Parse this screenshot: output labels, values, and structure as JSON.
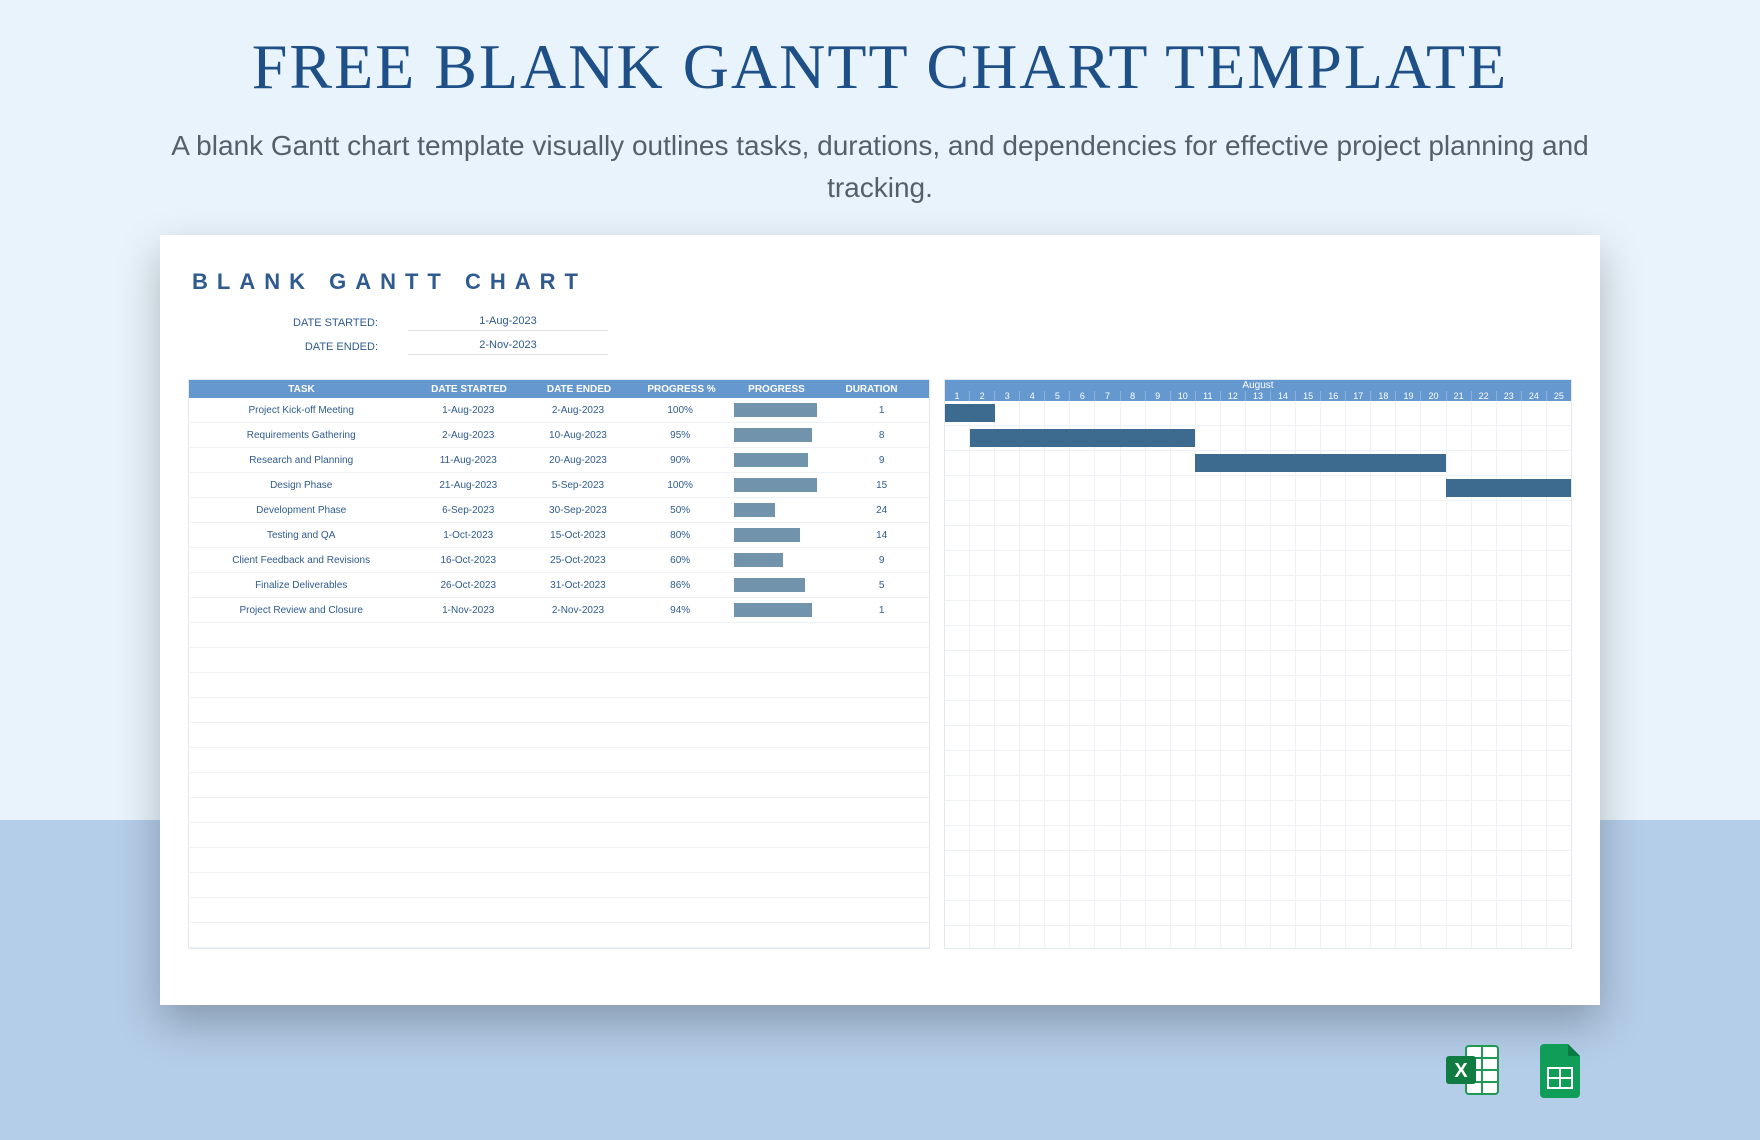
{
  "hero": {
    "title": "FREE BLANK GANTT CHART TEMPLATE",
    "subtitle": "A blank Gantt chart template visually outlines tasks, durations, and dependencies for effective project planning and tracking."
  },
  "sheet": {
    "title": "BLANK GANTT CHART",
    "meta_labels": {
      "started": "DATE STARTED:",
      "ended": "DATE ENDED:"
    },
    "meta_values": {
      "started": "1-Aug-2023",
      "ended": "2-Nov-2023"
    },
    "columns": {
      "task": "TASK",
      "date_started": "DATE STARTED",
      "date_ended": "DATE ENDED",
      "progress_pct": "PROGRESS %",
      "progress": "PROGRESS",
      "duration": "DURATION"
    },
    "rows": [
      {
        "task": "Project Kick-off Meeting",
        "date_started": "1-Aug-2023",
        "date_ended": "2-Aug-2023",
        "progress_pct": "100%",
        "duration": "1",
        "start_day": 1,
        "span": 2
      },
      {
        "task": "Requirements Gathering",
        "date_started": "2-Aug-2023",
        "date_ended": "10-Aug-2023",
        "progress_pct": "95%",
        "duration": "8",
        "start_day": 2,
        "span": 9
      },
      {
        "task": "Research and Planning",
        "date_started": "11-Aug-2023",
        "date_ended": "20-Aug-2023",
        "progress_pct": "90%",
        "duration": "9",
        "start_day": 11,
        "span": 10
      },
      {
        "task": "Design Phase",
        "date_started": "21-Aug-2023",
        "date_ended": "5-Sep-2023",
        "progress_pct": "100%",
        "duration": "15",
        "start_day": 21,
        "span": 5
      },
      {
        "task": "Development Phase",
        "date_started": "6-Sep-2023",
        "date_ended": "30-Sep-2023",
        "progress_pct": "50%",
        "duration": "24",
        "start_day": 0,
        "span": 0
      },
      {
        "task": "Testing and QA",
        "date_started": "1-Oct-2023",
        "date_ended": "15-Oct-2023",
        "progress_pct": "80%",
        "duration": "14",
        "start_day": 0,
        "span": 0
      },
      {
        "task": "Client Feedback and Revisions",
        "date_started": "16-Oct-2023",
        "date_ended": "25-Oct-2023",
        "progress_pct": "60%",
        "duration": "9",
        "start_day": 0,
        "span": 0
      },
      {
        "task": "Finalize Deliverables",
        "date_started": "26-Oct-2023",
        "date_ended": "31-Oct-2023",
        "progress_pct": "86%",
        "duration": "5",
        "start_day": 0,
        "span": 0
      },
      {
        "task": "Project Review and Closure",
        "date_started": "1-Nov-2023",
        "date_ended": "2-Nov-2023",
        "progress_pct": "94%",
        "duration": "1",
        "start_day": 0,
        "span": 0
      }
    ],
    "empty_rows": 13,
    "timeline": {
      "month": "August",
      "days": 25
    }
  },
  "icons": {
    "excel": "excel-icon",
    "sheets": "google-sheets-icon"
  },
  "colors": {
    "accent": "#6598cf",
    "bar": "#3d6b8f",
    "title": "#1e4f86"
  },
  "chart_data": {
    "type": "bar",
    "title": "BLANK GANTT CHART",
    "xlabel": "August",
    "ylabel": "Task",
    "categories": [
      "Project Kick-off Meeting",
      "Requirements Gathering",
      "Research and Planning",
      "Design Phase",
      "Development Phase",
      "Testing and QA",
      "Client Feedback and Revisions",
      "Finalize Deliverables",
      "Project Review and Closure"
    ],
    "series": [
      {
        "name": "Start (day of Aug)",
        "values": [
          1,
          2,
          11,
          21,
          null,
          null,
          null,
          null,
          null
        ]
      },
      {
        "name": "Duration (days)",
        "values": [
          1,
          8,
          9,
          15,
          24,
          14,
          9,
          5,
          1
        ]
      },
      {
        "name": "Progress %",
        "values": [
          100,
          95,
          90,
          100,
          50,
          80,
          60,
          86,
          94
        ]
      }
    ],
    "xlim": [
      1,
      25
    ]
  }
}
